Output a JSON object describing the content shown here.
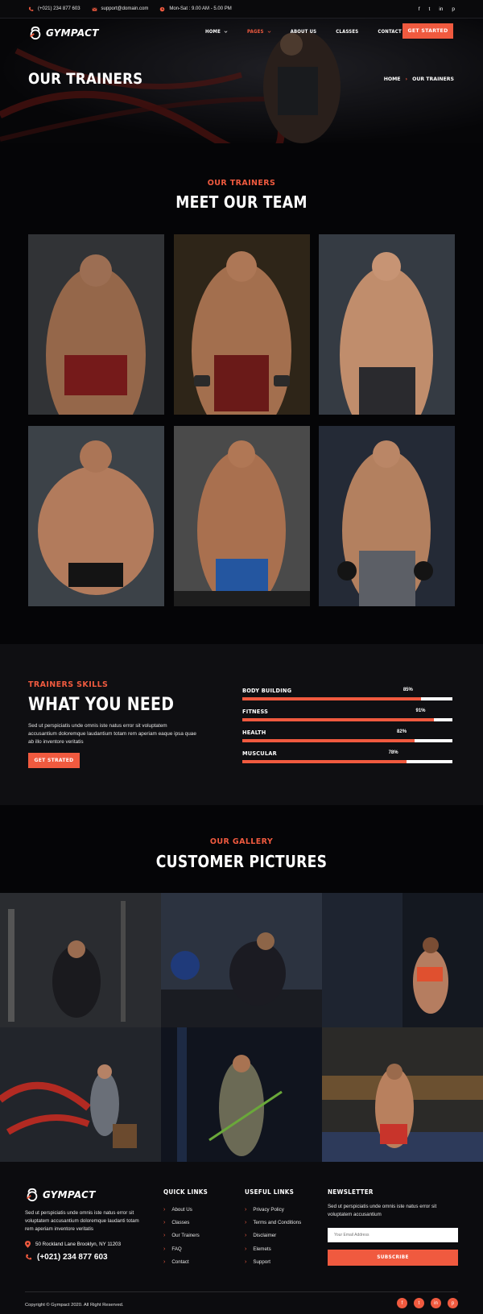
{
  "topbar": {
    "phone": "(+021) 234 877 603",
    "email": "support@domain.com",
    "hours": "Mon-Sat : 9.00 AM - 5.00 PM",
    "social": [
      "f",
      "t",
      "in",
      "p"
    ]
  },
  "brand": {
    "name": "GYMPACT"
  },
  "nav": {
    "items": [
      {
        "label": "HOME",
        "dropdown": true,
        "active": false
      },
      {
        "label": "PAGES",
        "dropdown": true,
        "active": true
      },
      {
        "label": "ABOUT US",
        "dropdown": false,
        "active": false
      },
      {
        "label": "CLASSES",
        "dropdown": false,
        "active": false
      },
      {
        "label": "CONTACT",
        "dropdown": true,
        "active": false
      }
    ],
    "cta": "GET STARTED"
  },
  "hero": {
    "title": "OUR TRAINERS",
    "breadcrumb": [
      "HOME",
      "OUR TRAINERS"
    ]
  },
  "team": {
    "eyebrow": "OUR TRAINERS",
    "title": "MEET OUR TEAM"
  },
  "skills": {
    "eyebrow": "TRAINERS SKILLS",
    "title": "WHAT YOU NEED",
    "text": "Sed ut perspiciatis unde omnis iste natus error sit voluptatem accusantium doloremque laudantium totam rem aperiam eaque ipsa quae ab illo inventore veritatis",
    "cta": "GET STRATED",
    "bars": [
      {
        "label": "BODY BUILDING",
        "percent_text": "85%",
        "value": 85
      },
      {
        "label": "FITNESS",
        "percent_text": "91%",
        "value": 91
      },
      {
        "label": "HEALTH",
        "percent_text": "82%",
        "value": 82
      },
      {
        "label": "MUSCULAR",
        "percent_text": "78%",
        "value": 78
      }
    ]
  },
  "gallery": {
    "eyebrow": "OUR GALLERY",
    "title": "CUSTOMER PICTURES"
  },
  "footer": {
    "about": "Sed ut perspiciatis unde omnis iste natus error sit voluptatem accusantium doloremque laudanti totam rem aperiam inventore veritatis",
    "address": "50 Rockland Lane Brooklyn, NY 11203",
    "phone": "(+021) 234 877 603",
    "quick_links": {
      "title": "QUICK LINKS",
      "items": [
        "About Us",
        "Classes",
        "Our Trainers",
        "FAQ",
        "Contact"
      ]
    },
    "useful_links": {
      "title": "USEFUL LINKS",
      "items": [
        "Privacy Policy",
        "Terms and Conditions",
        "Disclaimer",
        "Elemets",
        "Support"
      ]
    },
    "newsletter": {
      "title": "NEWSLETTER",
      "text": "Sed ut perspiciatis unde omnis iste natus error sit voluptatem accusantium",
      "placeholder": "Your Email Address",
      "button": "SUBSCRIBE"
    },
    "copyright": "Copyright © Gympact 2020. All Right Reserved.",
    "social": [
      "f",
      "t",
      "in",
      "p"
    ]
  },
  "colors": {
    "accent": "#f05a3f",
    "background": "#050507",
    "panel": "#0f0f12"
  }
}
